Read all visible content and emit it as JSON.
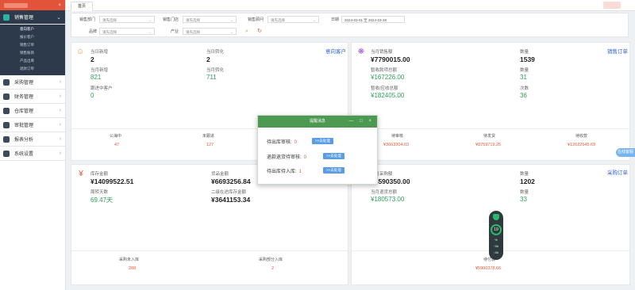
{
  "brand": {
    "close": "×"
  },
  "sidebar": {
    "groups": [
      {
        "label": "销售管理",
        "icon": "sales-icon",
        "color": "#2bb3a3",
        "active": true,
        "items": [
          "意向客户",
          "报价客户",
          "销售订单",
          "销售账目",
          "产品出库",
          "退款订单"
        ]
      },
      {
        "label": "采购管理",
        "icon": "purchase-icon",
        "color": "#3d4a5a"
      },
      {
        "label": "财务管理",
        "icon": "finance-icon",
        "color": "#3d4a5a"
      },
      {
        "label": "仓库管理",
        "icon": "warehouse-icon",
        "color": "#3d4a5a"
      },
      {
        "label": "审批管理",
        "icon": "approval-icon",
        "color": "#3d4a5a"
      },
      {
        "label": "报表分析",
        "icon": "report-icon",
        "color": "#3d4a5a"
      },
      {
        "label": "系统设置",
        "icon": "settings-icon",
        "color": "#3d4a5a"
      }
    ]
  },
  "tabs": {
    "home": "首页"
  },
  "filters": {
    "dept_label": "销售部门",
    "dept_value": "请先选择",
    "shop_label": "销售门店",
    "shop_value": "请先选择",
    "staff_label": "销售顾问",
    "staff_value": "请先选择",
    "date_label": "日期",
    "date_value": "2024-03-01 至 2024-03-28",
    "brand_label": "品牌",
    "brand_value": "请先选择",
    "industry_label": "产业",
    "industry_value": "请先选择"
  },
  "panel_customers": {
    "link": "意向客户",
    "today_new_label": "当日新增",
    "today_new": "2",
    "today_conv_label": "当日转化",
    "today_conv": "2",
    "month_new_label": "当月新增",
    "month_new": "821",
    "month_conv_label": "当月转化",
    "month_conv": "711",
    "in_progress_label": "跟进中客户",
    "in_progress": "0",
    "bottom": [
      {
        "label": "公海中",
        "value": "47"
      },
      {
        "label": "未跟进",
        "value": "127"
      }
    ]
  },
  "panel_sales": {
    "link": "销售订单",
    "month_sales_label": "当月销售额",
    "month_sales": "¥7790015.00",
    "count_label": "数量",
    "count": "1539",
    "received_label": "暂收款项总额",
    "received": "¥167226.00",
    "received_count_label": "数量",
    "received_count": "31",
    "pending_label": "暂收/应收总额",
    "pending": "¥182405.00",
    "pending_count_label": "次数",
    "pending_count": "36",
    "bottom": [
      {
        "label": "待审核",
        "value": "¥3663304.03"
      },
      {
        "label": "待发货",
        "value": "¥8759719.25"
      },
      {
        "label": "待收款",
        "value": "¥12622645.69"
      }
    ]
  },
  "panel_stock": {
    "stock_value_label": "库存金额",
    "stock_value": "¥14099522.51",
    "turnover_label": "周转天数",
    "turnover": "69.47天",
    "goods_value_label": "货品金额",
    "goods_value": "¥6693256.84",
    "other_label": "二级在途库存金额",
    "other": "¥3641153.34",
    "bottom": [
      {
        "label": "采购未入库",
        "value": "288"
      },
      {
        "label": "采购部分入库",
        "value": "2"
      }
    ]
  },
  "panel_purchase": {
    "link": "采购订单",
    "month_purchase_label": "当月采购额",
    "month_purchase": "¥4590350.00",
    "count_label": "数量",
    "count": "1202",
    "return_label": "当月退货总额",
    "return_value": "¥180573.00",
    "return_count_label": "数量",
    "return_count": "33",
    "bottom": [
      {
        "label": "待付款",
        "value": "¥5900378.66"
      }
    ]
  },
  "modal": {
    "title": "提醒消息",
    "controls": "— □ ×",
    "rows": [
      {
        "label": "待出库审核:",
        "count": "0",
        "button": ">>去处理"
      },
      {
        "label": "退款退货待审核:",
        "count": "0",
        "button": ">>去处理"
      },
      {
        "label": "待出库待入库:",
        "count": "1",
        "button": ">>去处理"
      }
    ]
  },
  "side_pill": "在线客服",
  "widget": {
    "value": "19",
    "unit": "%",
    "up": "↑0k",
    "down": "↓0k"
  },
  "colors": {
    "accent_green": "#4c9a52",
    "link_blue": "#2f5fd3",
    "brand_red": "#e2533a"
  }
}
